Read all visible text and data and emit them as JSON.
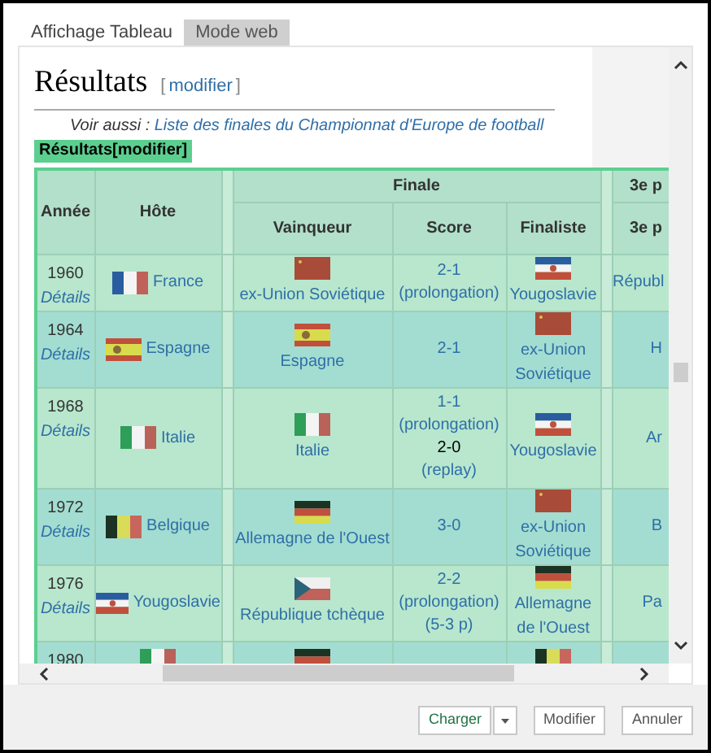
{
  "tabs": [
    {
      "label": "Affichage Tableau",
      "selected": false
    },
    {
      "label": "Mode web",
      "selected": true
    }
  ],
  "page": {
    "heading": "Résultats",
    "edit_bracket_open": "[",
    "edit_link": "modifier",
    "edit_bracket_close": "]",
    "see_also_prefix": "Voir aussi : ",
    "see_also_link": "Liste des finales du Championnat d'Europe de football"
  },
  "table_overlay": {
    "tab_label": "Résultats[modifier]",
    "group_header": "Finale",
    "group_header_2": "3e p",
    "columns": [
      "Année",
      "Hôte",
      "Vainqueur",
      "Score",
      "Finaliste",
      "3e p"
    ],
    "rows": [
      {
        "year": "1960",
        "details": "Détails",
        "host": "France",
        "host_flag": {
          "kind": "fr"
        },
        "winner": "ex-Union Soviétique",
        "winner_flag": {
          "kind": "su"
        },
        "score": [
          {
            "text": "2-1",
            "link": true
          },
          {
            "text": "(prolongation)",
            "link": true
          }
        ],
        "finalist": "Yougoslavie",
        "finalist_flag": {
          "kind": "yu"
        },
        "column_3": "Républ"
      },
      {
        "year": "1964",
        "details": "Détails",
        "host": "Espagne",
        "host_flag": {
          "kind": "es"
        },
        "winner": "Espagne",
        "winner_flag": {
          "kind": "es"
        },
        "score": [
          {
            "text": "2-1",
            "link": true
          }
        ],
        "finalist": "ex-Union Soviétique",
        "finalist_flag": {
          "kind": "su"
        },
        "column_3": "H"
      },
      {
        "year": "1968",
        "details": "Détails",
        "host": "Italie",
        "host_flag": {
          "kind": "it"
        },
        "winner": "Italie",
        "winner_flag": {
          "kind": "it"
        },
        "score": [
          {
            "text": "1-1",
            "link": true
          },
          {
            "text": "(prolongation)",
            "link": true
          },
          {
            "text": "2-0",
            "link": false
          },
          {
            "text": "(replay)",
            "link": true
          }
        ],
        "finalist": "Yougoslavie",
        "finalist_flag": {
          "kind": "yu"
        },
        "column_3": "Ar"
      },
      {
        "year": "1972",
        "details": "Détails",
        "host": "Belgique",
        "host_flag": {
          "kind": "be"
        },
        "winner": "Allemagne de l'Ouest",
        "winner_flag": {
          "kind": "de"
        },
        "score": [
          {
            "text": "3-0",
            "link": true
          }
        ],
        "finalist": "ex-Union Soviétique",
        "finalist_flag": {
          "kind": "su"
        },
        "column_3": "B"
      },
      {
        "year": "1976",
        "details": "Détails",
        "host": "Yougoslavie",
        "host_flag": {
          "kind": "yu"
        },
        "winner": "République tchèque",
        "winner_flag": {
          "kind": "cz"
        },
        "score": [
          {
            "text": "2-2",
            "link": true
          },
          {
            "text": "(prolongation)",
            "link": true
          },
          {
            "text": "(5-3 p)",
            "link": true
          }
        ],
        "finalist": "Allemagne de l'Ouest",
        "finalist_flag": {
          "kind": "de"
        },
        "column_3": "Pa"
      },
      {
        "year": "1980",
        "host_flag": {
          "kind": "it"
        },
        "winner_flag": {
          "kind": "de"
        },
        "finalist_flag": {
          "kind": "be"
        }
      }
    ]
  },
  "buttons": [
    {
      "label": "Charger",
      "kind": "split"
    },
    {
      "label": "Modifier",
      "kind": "plain"
    },
    {
      "label": "Annuler",
      "kind": "plain"
    }
  ]
}
